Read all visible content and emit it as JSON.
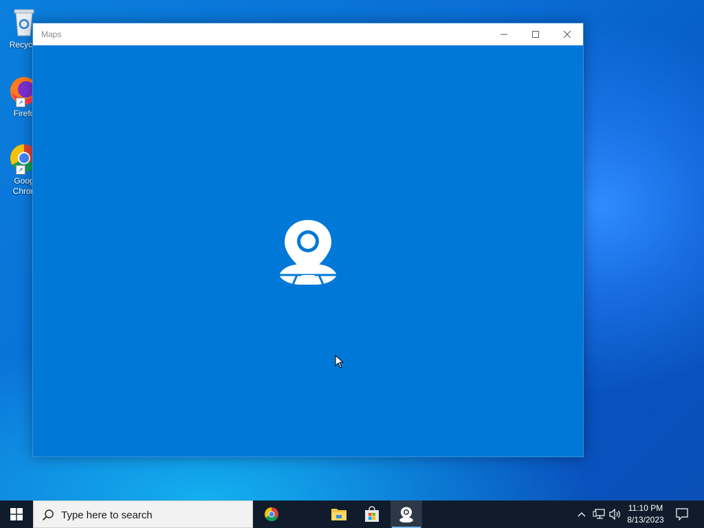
{
  "desktop": {
    "icons": [
      {
        "label": "Recycle",
        "icon": "recycle-bin-icon"
      },
      {
        "label": "Firefo",
        "icon": "firefox-icon"
      },
      {
        "label": "Goog\nChron",
        "icon": "chrome-icon"
      }
    ]
  },
  "window": {
    "title": "Maps",
    "minimize_icon": "minimize-icon",
    "maximize_icon": "maximize-icon",
    "close_icon": "close-icon",
    "splash_icon": "maps-pin-icon",
    "background_color": "#0078d7"
  },
  "taskbar": {
    "start_icon": "windows-logo-icon",
    "search_placeholder": "Type here to search",
    "apps": [
      {
        "icon": "chrome-icon"
      },
      {
        "icon": "file-explorer-icon"
      },
      {
        "icon": "microsoft-store-icon"
      },
      {
        "icon": "maps-pin-icon",
        "active": true
      }
    ],
    "tray": {
      "chevron_icon": "chevron-up-icon",
      "network_icon": "network-icon",
      "volume_icon": "volume-icon",
      "time": "11:10 PM",
      "date": "8/13/2023",
      "notification_icon": "notification-icon"
    }
  }
}
